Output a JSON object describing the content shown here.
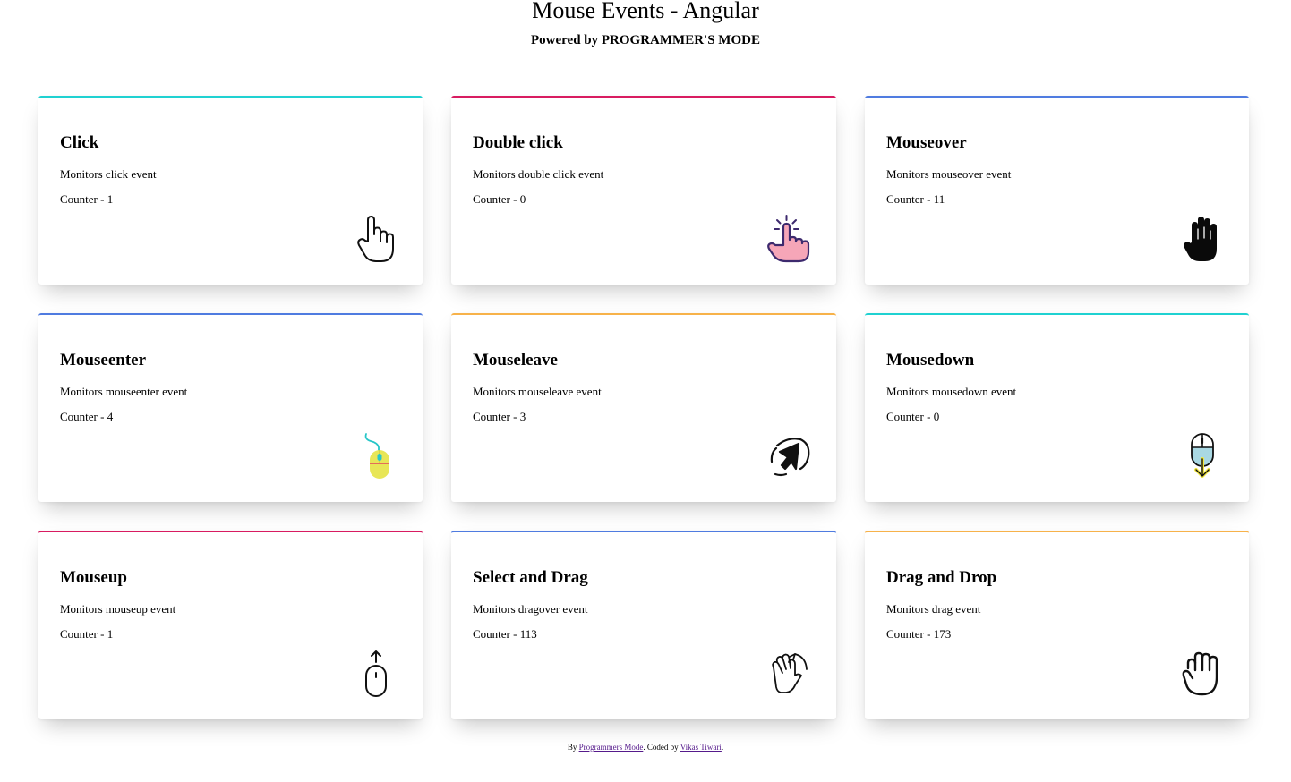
{
  "header": {
    "title": "Mouse Events - Angular",
    "subtitle": "Powered by PROGRAMMER'S MODE"
  },
  "colors": {
    "cyan": "#1fd1d1",
    "pink": "#d81b60",
    "blue": "#4f7be0",
    "orange": "#f7b24a"
  },
  "cards": [
    {
      "title": "Click",
      "desc": "Monitors click event",
      "counter": "Counter - 1",
      "accent": "#1fd1d1",
      "icon": "pointing-hand-icon"
    },
    {
      "title": "Double click",
      "desc": "Monitors double click event",
      "counter": "Counter - 0",
      "accent": "#d81b60",
      "icon": "double-tap-hand-icon"
    },
    {
      "title": "Mouseover",
      "desc": "Monitors mouseover event",
      "counter": "Counter - 11",
      "accent": "#4f7be0",
      "icon": "raised-hand-icon"
    },
    {
      "title": "Mouseenter",
      "desc": "Monitors mouseenter event",
      "counter": "Counter - 4",
      "accent": "#4f7be0",
      "icon": "computer-mouse-icon"
    },
    {
      "title": "Mouseleave",
      "desc": "Monitors mouseleave event",
      "counter": "Counter - 3",
      "accent": "#f7b24a",
      "icon": "cursor-exit-icon"
    },
    {
      "title": "Mousedown",
      "desc": "Monitors mousedown event",
      "counter": "Counter - 0",
      "accent": "#1fd1d1",
      "icon": "mouse-scroll-down-icon"
    },
    {
      "title": "Mouseup",
      "desc": "Monitors mouseup event",
      "counter": "Counter - 1",
      "accent": "#d81b60",
      "icon": "mouse-scroll-up-icon"
    },
    {
      "title": "Select and Drag",
      "desc": "Monitors dragover event",
      "counter": "Counter - 113",
      "accent": "#4f7be0",
      "icon": "drag-hand-icon"
    },
    {
      "title": "Drag and Drop",
      "desc": "Monitors drag event",
      "counter": "Counter - 173",
      "accent": "#f7b24a",
      "icon": "grab-hand-icon"
    }
  ],
  "footer": {
    "by": "By",
    "link1": "Programmers Mode",
    "middle": ". Coded by",
    "link2": "Vikas Tiwari",
    "end": "."
  }
}
